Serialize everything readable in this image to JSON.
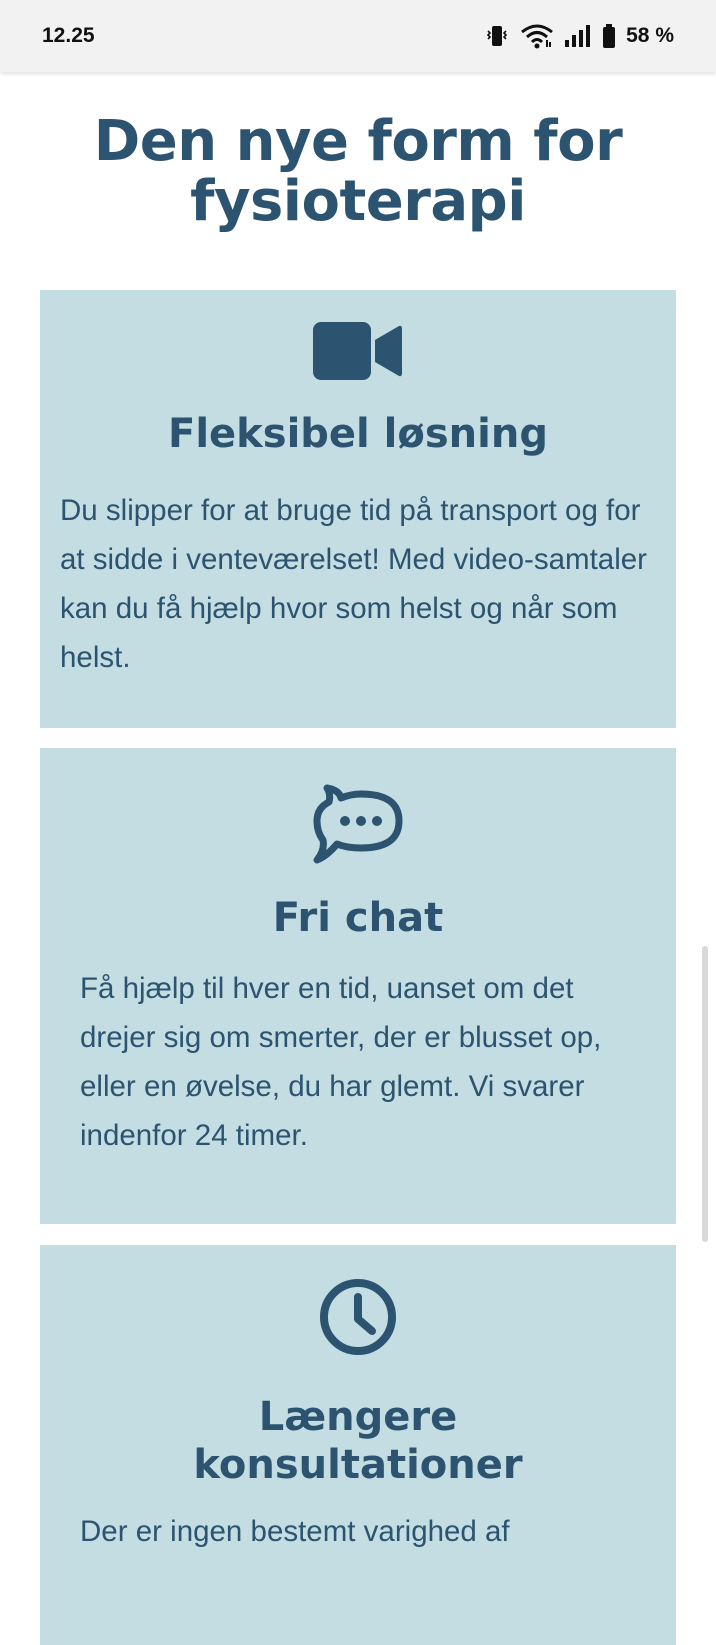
{
  "status": {
    "time": "12.25",
    "battery_text": "58 %"
  },
  "page": {
    "title": "Den nye form for fysioterapi"
  },
  "cards": [
    {
      "icon": "video-camera-icon",
      "title": "Fleksibel løsning",
      "text": "Du slipper for at bruge tid på transport og for at sidde i venteværelset! Med video-samtaler kan du få hjælp hvor som helst og når som helst."
    },
    {
      "icon": "chat-bubble-icon",
      "title": "Fri chat",
      "text": "Få hjælp til hver en tid, uanset om det drejer sig om smerter, der er blusset op, eller en øvelse, du har glemt. Vi svarer indenfor 24 timer."
    },
    {
      "icon": "clock-icon",
      "title": "Længere konsultationer",
      "text": "Der er ingen bestemt varighed af"
    }
  ],
  "colors": {
    "primary": "#2c5470",
    "card_background": "#c4dde3",
    "statusbar_background": "#f2f2f2"
  }
}
